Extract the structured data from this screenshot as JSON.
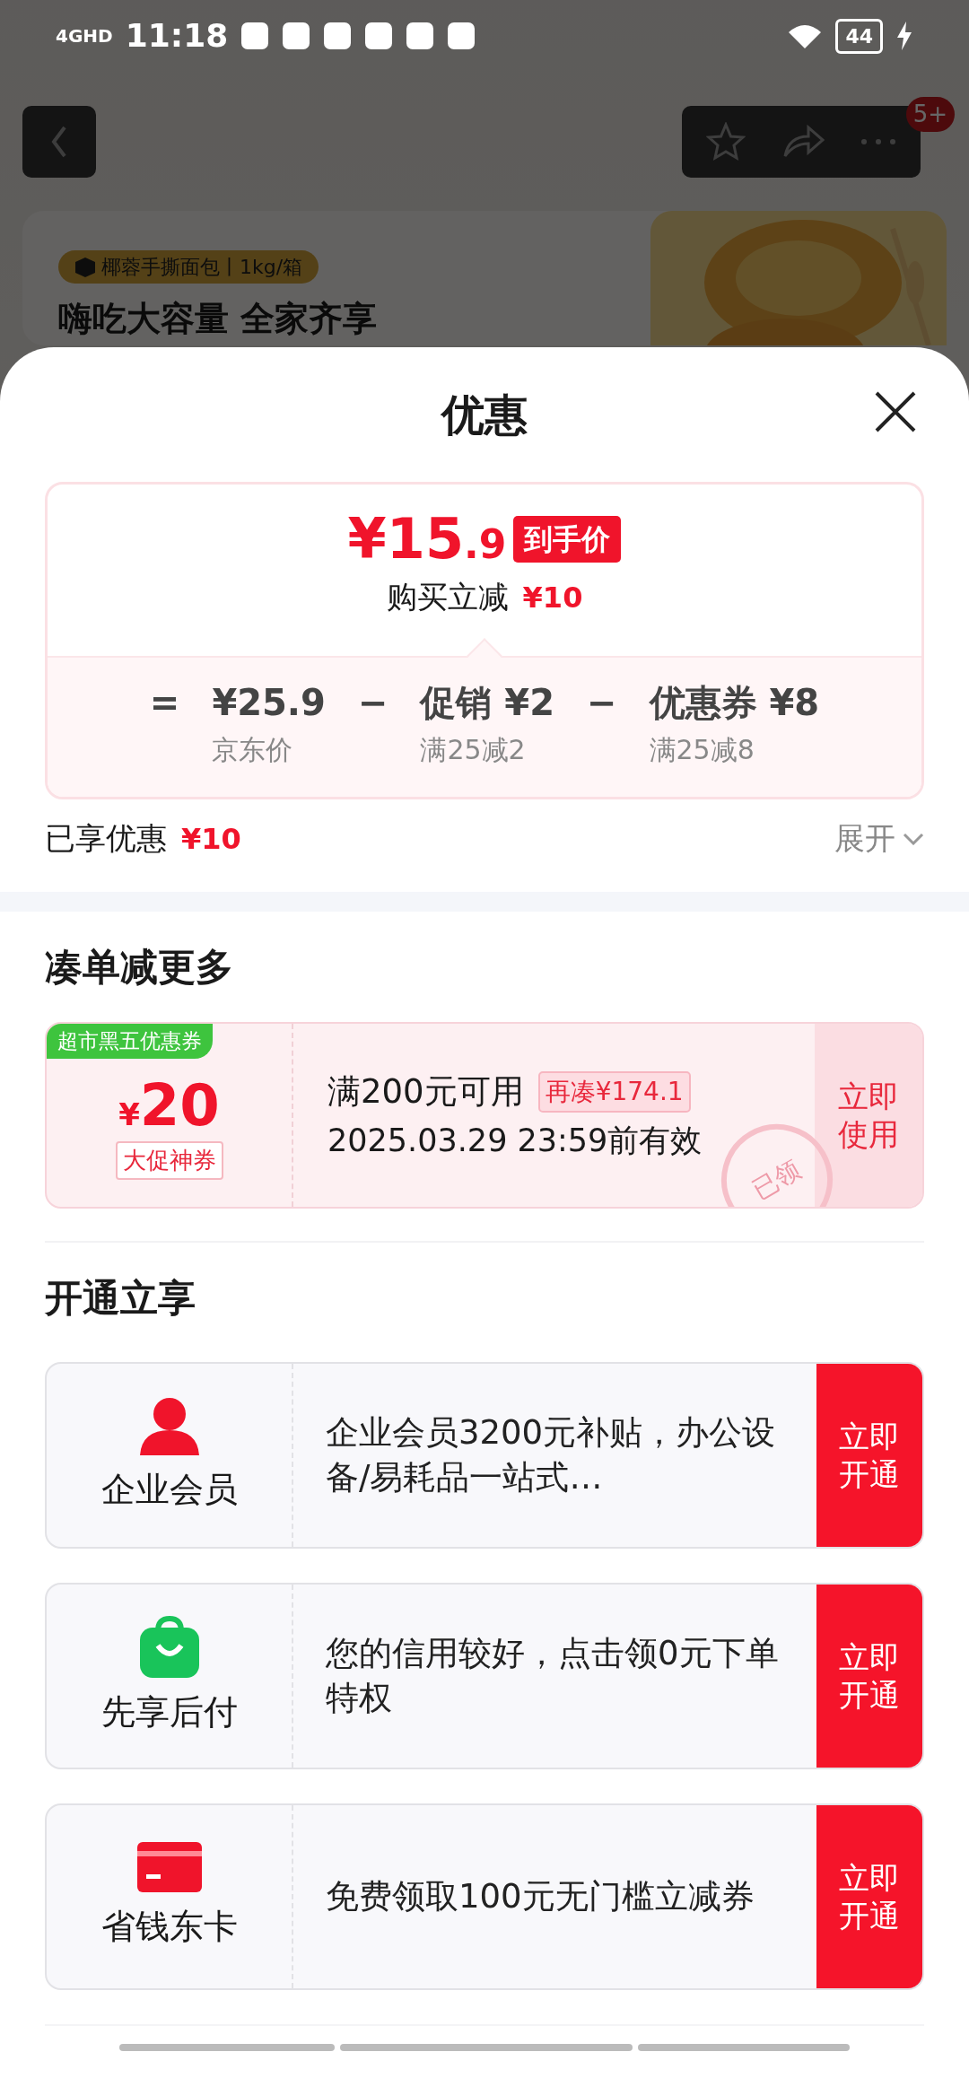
{
  "status_bar": {
    "network": "4GHD",
    "time": "11:18",
    "battery": "44"
  },
  "header": {
    "badge": "5+"
  },
  "product": {
    "tag": "椰蓉手撕面包丨1kg/箱",
    "headline": "嗨吃大容量 全家齐享"
  },
  "sheet": {
    "title": "优惠"
  },
  "price_card": {
    "price_main": "¥15",
    "price_decimal": ".9",
    "price_tag": "到手价",
    "saving_label": "购买立减",
    "saving_amount": "¥10",
    "breakdown": [
      {
        "operator": "=",
        "amount": "¥25.9",
        "note": "京东价"
      },
      {
        "operator": "−",
        "label": "促销",
        "amount": "¥2",
        "note": "满25减2"
      },
      {
        "operator": "−",
        "label": "优惠券",
        "amount": "¥8",
        "note": "满25减8"
      }
    ]
  },
  "enjoyed": {
    "label": "已享优惠",
    "amount": "¥10",
    "expand": "展开"
  },
  "bundle": {
    "title": "凑单减更多",
    "coupons": [
      {
        "ribbon": "超市黑五优惠券",
        "currency": "¥",
        "amount": "20",
        "type": "大促神券",
        "condition": "满200元可用",
        "gap": "再凑¥174.1",
        "validity": "2025.03.29 23:59前有效",
        "claimed": true,
        "stamp": "已领",
        "action": "立即使用"
      }
    ]
  },
  "services": {
    "title": "开通立享",
    "items": [
      {
        "kind": "member",
        "name": "企业会员",
        "description": "企业会员3200元补贴，办公设备/易耗品一站式…",
        "action": "立即开通"
      },
      {
        "kind": "paylater",
        "name": "先享后付",
        "description": "您的信用较好，点击领0元下单特权",
        "action": "立即开通"
      },
      {
        "kind": "card",
        "name": "省钱东卡",
        "description": "免费领取100元无门槛立减券",
        "action": "立即开通"
      }
    ]
  }
}
